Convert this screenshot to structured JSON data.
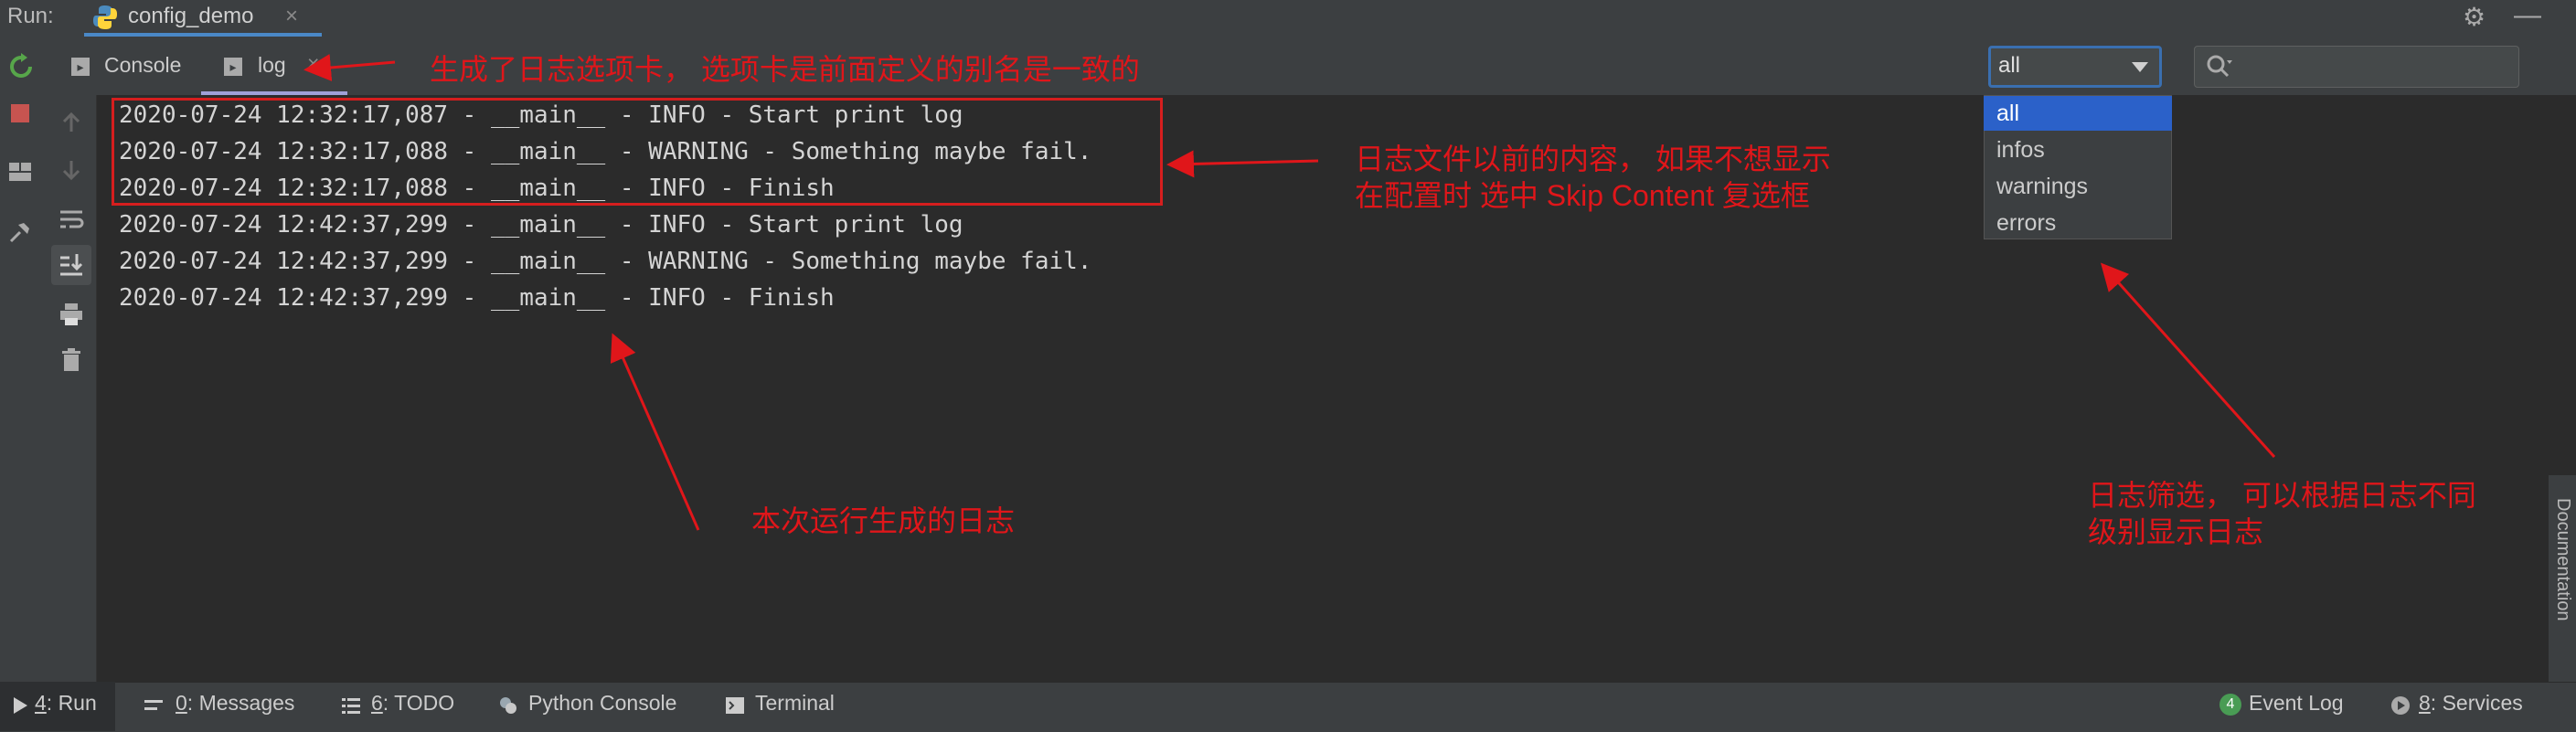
{
  "run_bar": {
    "label": "Run:",
    "tab_title": "config_demo",
    "close_glyph": "×"
  },
  "sub_tabs": [
    {
      "label": "Console"
    },
    {
      "label": "log"
    }
  ],
  "filter": {
    "selected": "all",
    "options": [
      "all",
      "infos",
      "warnings",
      "errors"
    ],
    "search_placeholder": ""
  },
  "log_lines": [
    "2020-07-24 12:32:17,087 - __main__ - INFO - Start print log",
    "2020-07-24 12:32:17,088 - __main__ - WARNING - Something maybe fail.",
    "2020-07-24 12:32:17,088 - __main__ - INFO - Finish",
    "2020-07-24 12:42:37,299 - __main__ - INFO - Start print log",
    "2020-07-24 12:42:37,299 - __main__ - WARNING - Something maybe fail.",
    "2020-07-24 12:42:37,299 - __main__ - INFO - Finish"
  ],
  "annotations": {
    "tab_note": "生成了日志选项卡， 选项卡是前面定义的别名是一致的",
    "old_content_line1": "日志文件以前的内容， 如果不想显示",
    "old_content_line2": "在配置时 选中 Skip Content 复选框",
    "this_run": "本次运行生成的日志",
    "filter_line1": "日志筛选， 可以根据日志不同",
    "filter_line2": "级别显示日志"
  },
  "right_strip": {
    "label": "Documentation"
  },
  "status_bar": {
    "run_num": "4",
    "run_label": ": Run",
    "messages_num": "0",
    "messages_label": ": Messages",
    "todo_num": "6",
    "todo_label": ": TODO",
    "python_console": "Python Console",
    "terminal": "Terminal",
    "event_log_badge": "4",
    "event_log": "Event Log",
    "services_num": "8",
    "services_label": ": Services"
  },
  "colors": {
    "accent_blue": "#2b61c9",
    "annotation_red": "#e0161a",
    "background": "#2b2b2b",
    "panel": "#3c3f41"
  },
  "icons": [
    "python-icon",
    "gear-icon",
    "minimize-icon",
    "rerun-icon",
    "stop-icon",
    "layout-icon",
    "pin-icon",
    "up-arrow-icon",
    "down-arrow-icon",
    "soft-wrap-icon",
    "scroll-to-end-icon",
    "print-icon",
    "trash-icon",
    "search-icon",
    "run-icon",
    "messages-icon",
    "todo-icon",
    "python-console-icon",
    "terminal-icon",
    "event-log-icon",
    "services-icon"
  ]
}
